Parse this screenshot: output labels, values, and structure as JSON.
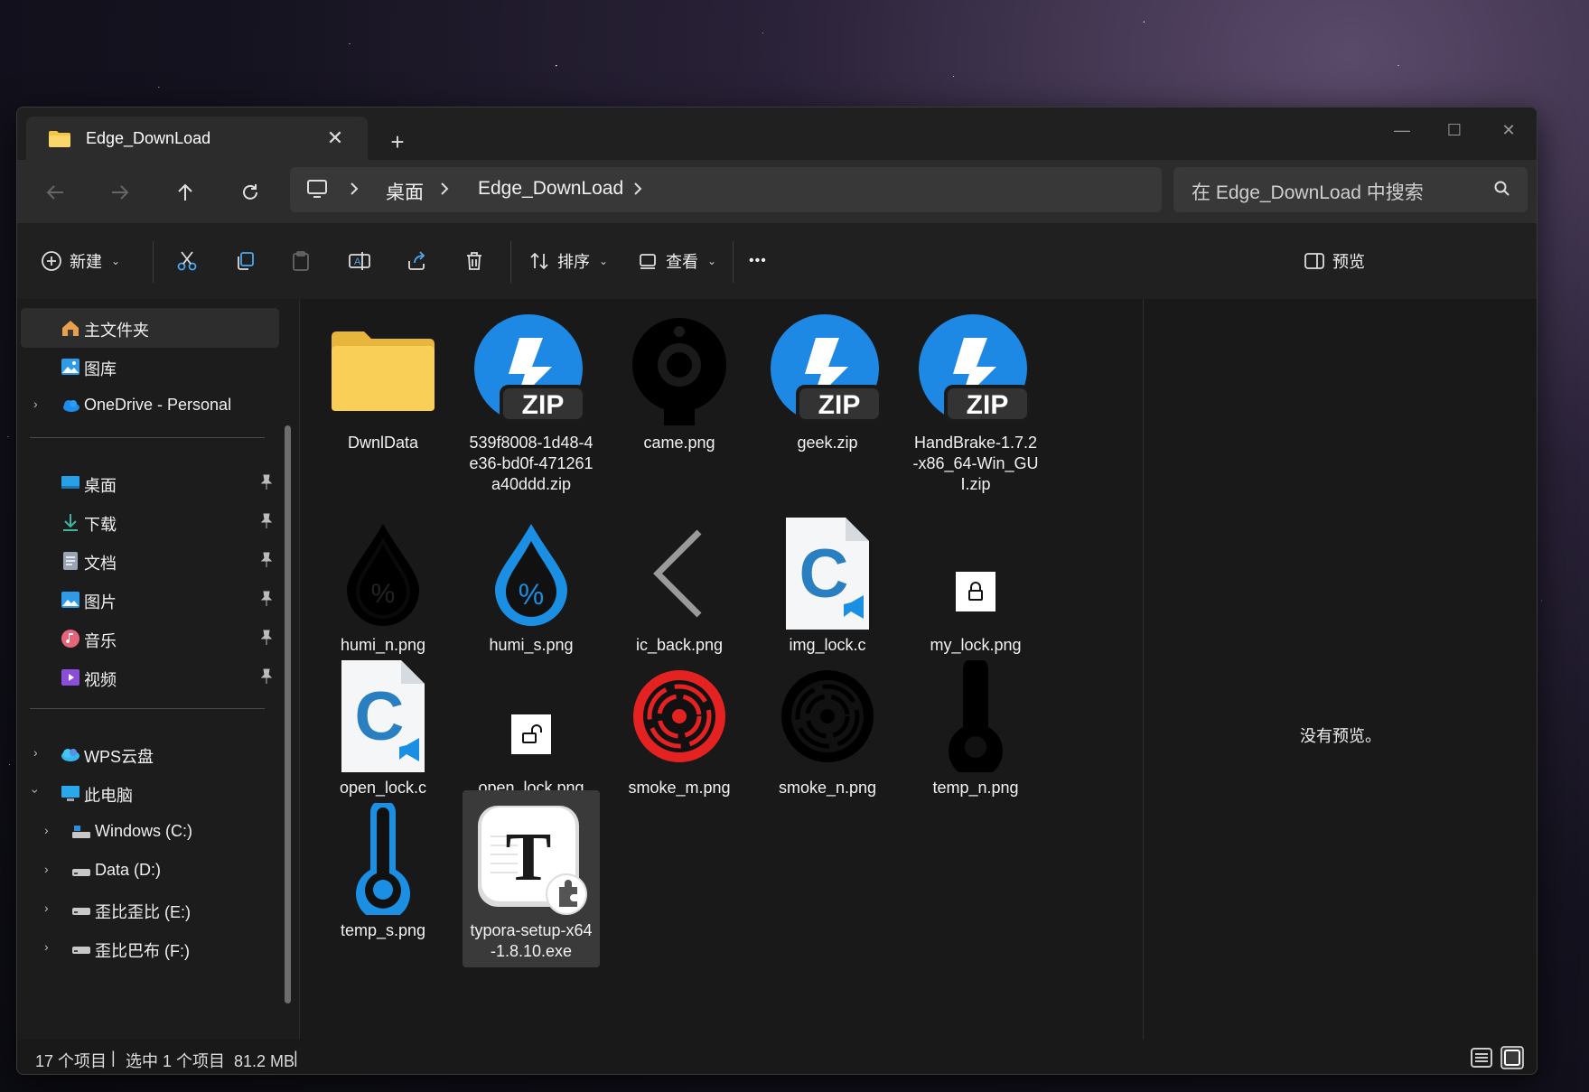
{
  "window": {
    "tab_title": "Edge_DownLoad",
    "tab_close": "✕",
    "new_tab": "+",
    "minimize": "—",
    "maximize": "☐",
    "close": "✕"
  },
  "nav": {
    "breadcrumbs": [
      "桌面",
      "Edge_DownLoad"
    ],
    "search_placeholder": "在 Edge_DownLoad 中搜索"
  },
  "toolbar": {
    "new_label": "新建",
    "sort_label": "排序",
    "view_label": "查看",
    "more_label": "•••",
    "preview_label": "预览"
  },
  "sidebar": {
    "top": [
      {
        "label": "主文件夹",
        "icon": "home-icon"
      },
      {
        "label": "图库",
        "icon": "gallery-icon"
      },
      {
        "label": "OneDrive - Personal",
        "icon": "onedrive-icon"
      }
    ],
    "pinned": [
      {
        "label": "桌面",
        "icon": "desktop-icon"
      },
      {
        "label": "下载",
        "icon": "download-icon"
      },
      {
        "label": "文档",
        "icon": "documents-icon"
      },
      {
        "label": "图片",
        "icon": "pictures-icon"
      },
      {
        "label": "音乐",
        "icon": "music-icon"
      },
      {
        "label": "视频",
        "icon": "videos-icon"
      }
    ],
    "bottom": [
      {
        "label": "WPS云盘",
        "icon": "wps-cloud-icon"
      },
      {
        "label": "此电脑",
        "icon": "this-pc-icon"
      },
      {
        "label": "Windows (C:)",
        "icon": "drive-c-icon"
      },
      {
        "label": "Data (D:)",
        "icon": "drive-icon"
      },
      {
        "label": "歪比歪比 (E:)",
        "icon": "drive-icon"
      },
      {
        "label": "歪比巴布 (F:)",
        "icon": "drive-icon"
      }
    ]
  },
  "files": [
    {
      "name": "DwnlData",
      "icon": "folder-icon"
    },
    {
      "name": "539f8008-1d48-4e36-bd0f-471261a40ddd.zip",
      "icon": "zip-icon"
    },
    {
      "name": "came.png",
      "icon": "camera-icon"
    },
    {
      "name": "geek.zip",
      "icon": "zip-icon"
    },
    {
      "name": "HandBrake-1.7.2-x86_64-Win_GUI.zip",
      "icon": "zip-icon"
    },
    {
      "name": "humi_n.png",
      "icon": "humidity-icon"
    },
    {
      "name": "humi_s.png",
      "icon": "humidity-icon"
    },
    {
      "name": "ic_back.png",
      "icon": "back-chevron-icon"
    },
    {
      "name": "img_lock.c",
      "icon": "c-file-icon"
    },
    {
      "name": "my_lock.png",
      "icon": "lock-icon"
    },
    {
      "name": "open_lock.c",
      "icon": "c-file-icon"
    },
    {
      "name": "open_lock.png",
      "icon": "unlock-icon"
    },
    {
      "name": "smoke_m.png",
      "icon": "smoke-detector-icon"
    },
    {
      "name": "smoke_n.png",
      "icon": "smoke-detector-icon"
    },
    {
      "name": "temp_n.png",
      "icon": "thermometer-icon"
    },
    {
      "name": "temp_s.png",
      "icon": "thermometer-icon"
    },
    {
      "name": "typora-setup-x64-1.8.10.exe",
      "icon": "typora-icon"
    }
  ],
  "preview": {
    "message": "没有预览。"
  },
  "status": {
    "count": "17 个项目",
    "selection": "选中 1 个项目  81.2 MB"
  },
  "colors": {
    "accent_blue": "#1a8fe3",
    "zip_blue": "#1e88e5",
    "smoke_red": "#e52222",
    "folder_yellow": "#f7cf55"
  }
}
